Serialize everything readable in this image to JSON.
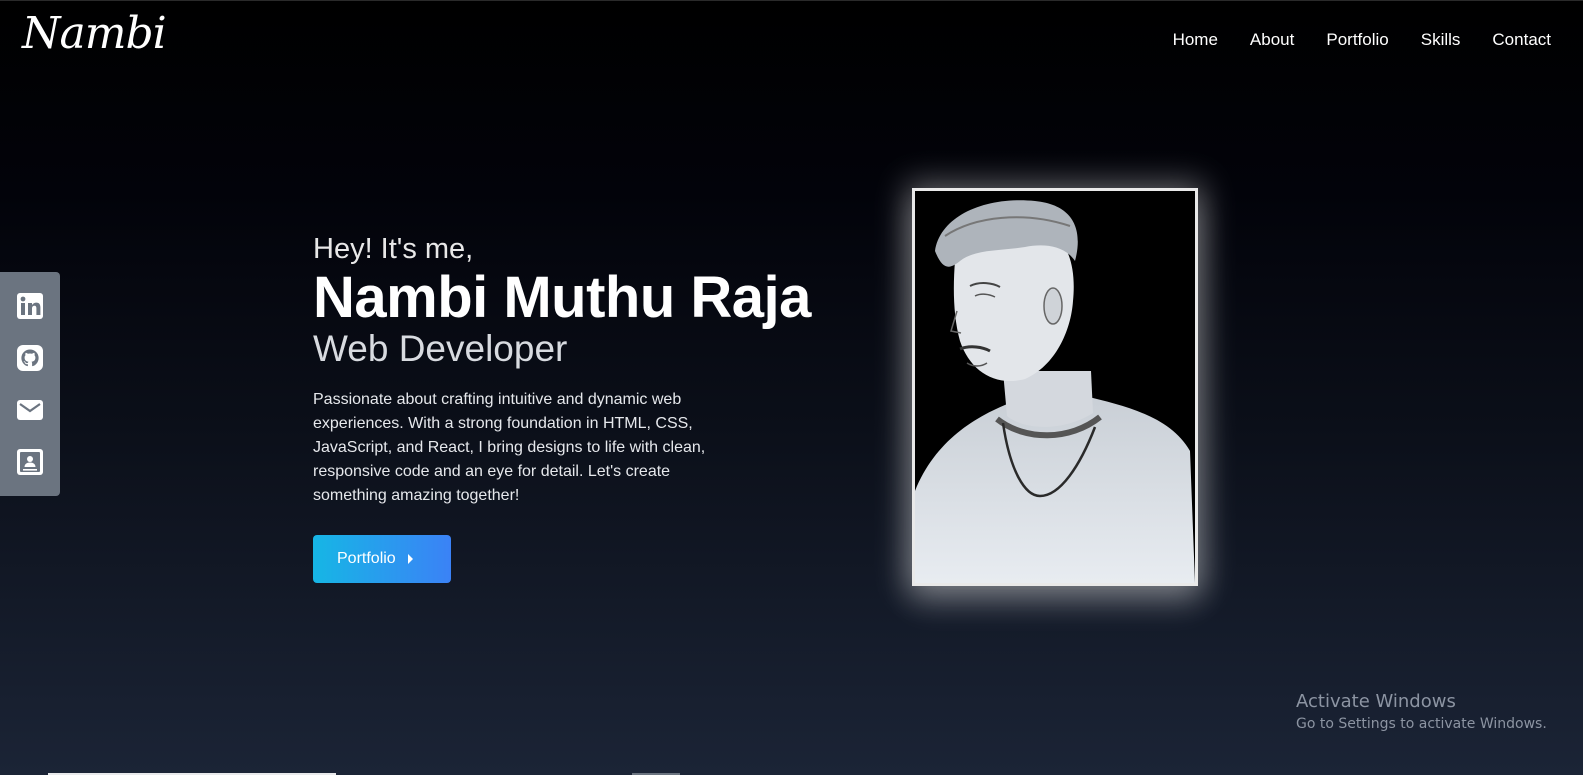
{
  "header": {
    "logo": "Nambi",
    "nav": [
      "Home",
      "About",
      "Portfolio",
      "Skills",
      "Contact"
    ]
  },
  "social": [
    {
      "icon": "linkedin-icon"
    },
    {
      "icon": "github-icon"
    },
    {
      "icon": "mail-icon"
    },
    {
      "icon": "contact-card-icon"
    }
  ],
  "hero": {
    "greeting": "Hey! It's me,",
    "name": "Nambi Muthu Raja",
    "role": "Web Developer",
    "description": "Passionate about crafting intuitive and dynamic web experiences. With a strong foundation in HTML, CSS, JavaScript, and React, I bring designs to life with clean, responsive code and an eye for detail. Let's create something amazing together!",
    "cta_label": "Portfolio"
  },
  "watermark": {
    "title": "Activate Windows",
    "subtitle": "Go to Settings to activate Windows."
  },
  "colors": {
    "sidebar": "#6b7480",
    "cta_start": "#16b6e5",
    "cta_end": "#3b82f6",
    "background_top": "#000000",
    "background_bottom": "#1b2436"
  }
}
